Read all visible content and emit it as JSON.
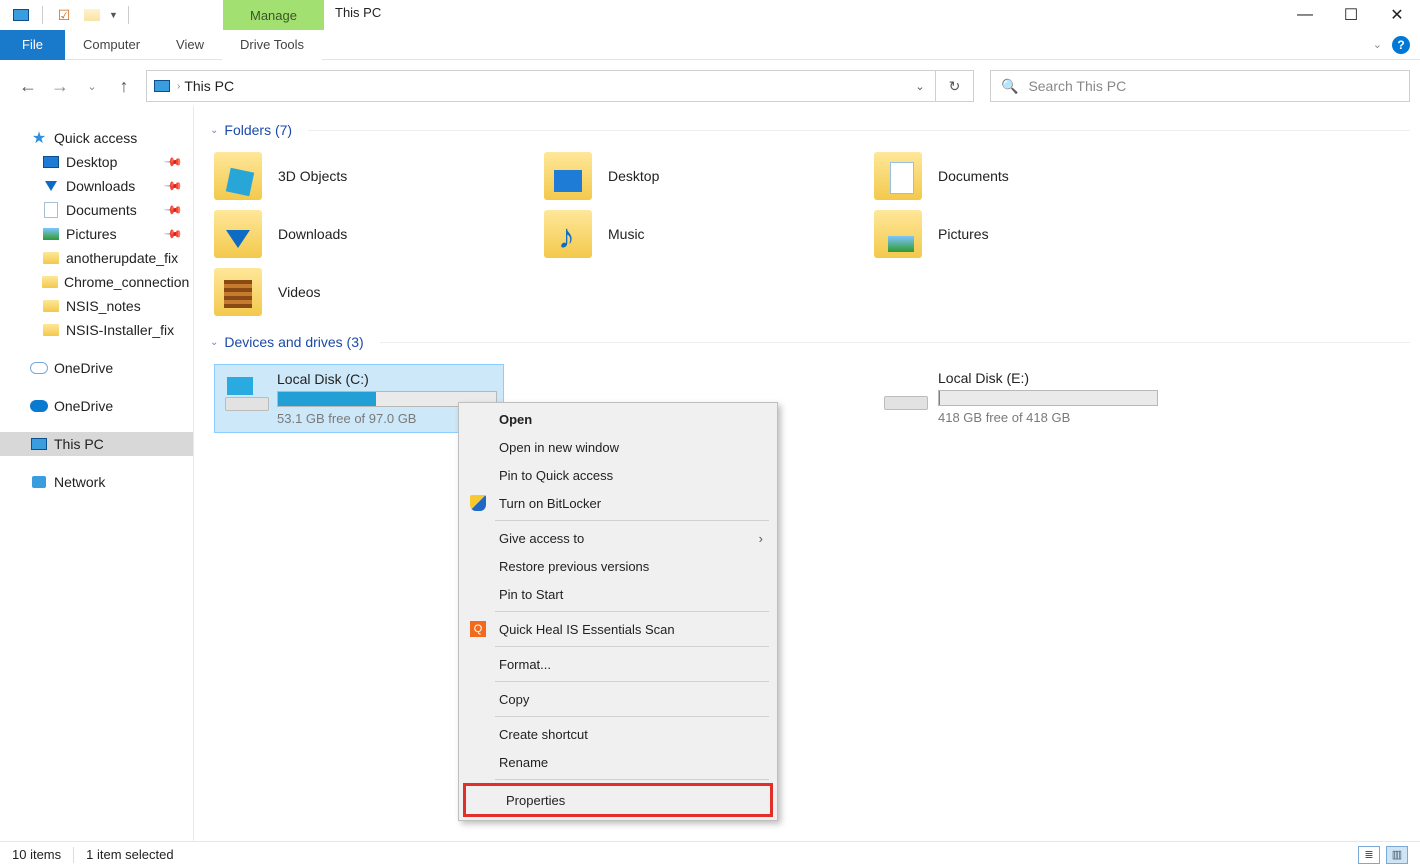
{
  "window": {
    "title": "This PC",
    "manage_tab_header": "Manage"
  },
  "ribbon": {
    "file": "File",
    "tabs": [
      "Computer",
      "View"
    ],
    "context_tab": "Drive Tools"
  },
  "nav": {
    "breadcrumb": "This PC",
    "search_placeholder": "Search This PC"
  },
  "sidebar": {
    "quick_access": "Quick access",
    "pinned": [
      {
        "label": "Desktop",
        "icon": "monitor",
        "pinned": true
      },
      {
        "label": "Downloads",
        "icon": "dl",
        "pinned": true
      },
      {
        "label": "Documents",
        "icon": "doc",
        "pinned": true
      },
      {
        "label": "Pictures",
        "icon": "pic",
        "pinned": true
      },
      {
        "label": "anotherupdate_fix",
        "icon": "folder",
        "pinned": false
      },
      {
        "label": "Chrome_connection",
        "icon": "folder",
        "pinned": false
      },
      {
        "label": "NSIS_notes",
        "icon": "folder",
        "pinned": false
      },
      {
        "label": "NSIS-Installer_fix",
        "icon": "folder",
        "pinned": false
      }
    ],
    "onedrive1": "OneDrive",
    "onedrive2": "OneDrive",
    "this_pc": "This PC",
    "network": "Network"
  },
  "groups": {
    "folders_header": "Folders (7)",
    "drives_header": "Devices and drives (3)"
  },
  "folders": [
    {
      "label": "3D Objects",
      "cls": "obj3d"
    },
    {
      "label": "Desktop",
      "cls": "desktop"
    },
    {
      "label": "Documents",
      "cls": "docs"
    },
    {
      "label": "Downloads",
      "cls": "dl"
    },
    {
      "label": "Music",
      "cls": "music"
    },
    {
      "label": "Pictures",
      "cls": "pics"
    },
    {
      "label": "Videos",
      "cls": "video"
    }
  ],
  "drives": [
    {
      "label": "Local Disk (C:)",
      "free": "53.1 GB free of 97.0 GB",
      "pct": 45,
      "selected": true,
      "win": true
    },
    {
      "label": "",
      "free": "",
      "pct": 0,
      "selected": false,
      "win": false,
      "hidden": true
    },
    {
      "label": "Local Disk (E:)",
      "free": "418 GB free of 418 GB",
      "pct": 0.5,
      "selected": false,
      "win": false
    }
  ],
  "context_menu": {
    "open": "Open",
    "open_new": "Open in new window",
    "pin_qa": "Pin to Quick access",
    "bitlocker": "Turn on BitLocker",
    "give_access": "Give access to",
    "restore": "Restore previous versions",
    "pin_start": "Pin to Start",
    "quickheal": "Quick Heal IS Essentials Scan",
    "format": "Format...",
    "copy": "Copy",
    "shortcut": "Create shortcut",
    "rename": "Rename",
    "properties": "Properties"
  },
  "status": {
    "count": "10 items",
    "selected": "1 item selected"
  }
}
